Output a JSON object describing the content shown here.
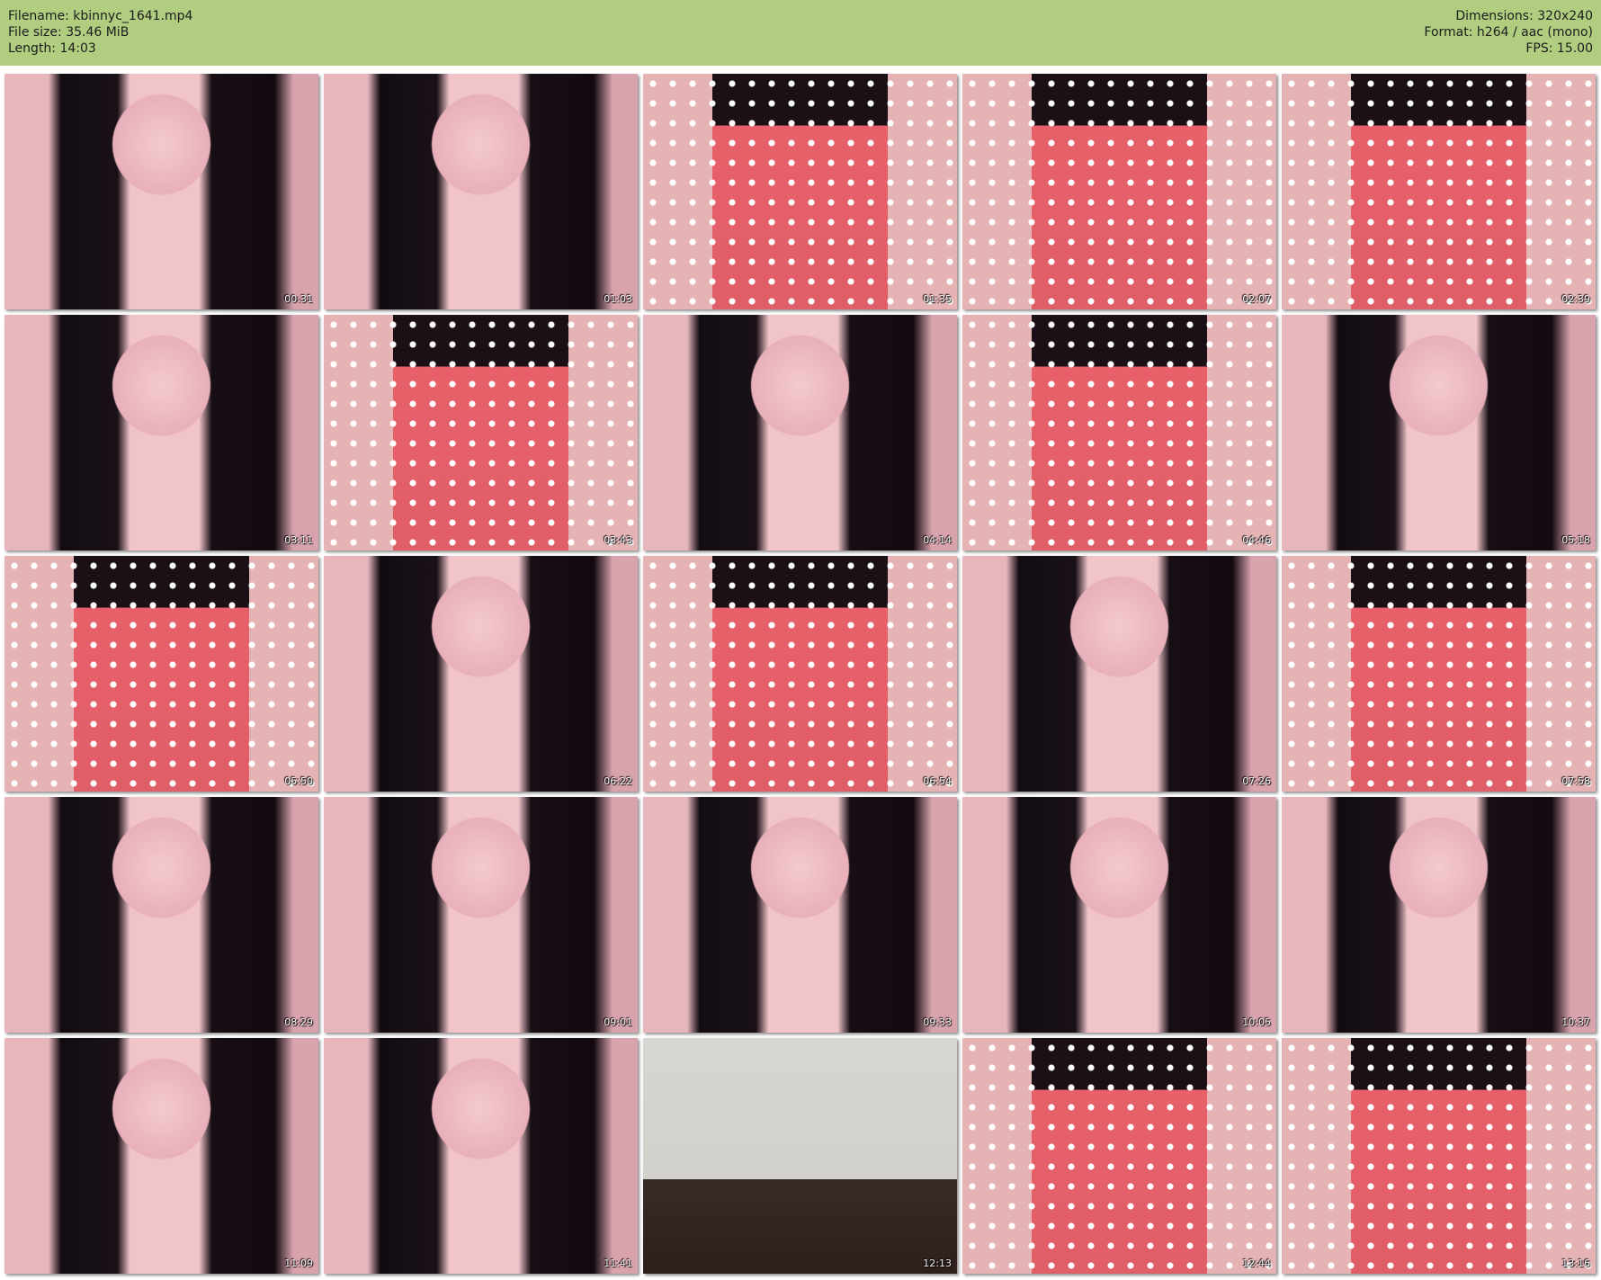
{
  "header": {
    "filename": "Filename: kbinnyc_1641.mp4",
    "filesize": "File size: 35.46 MiB",
    "length": "Length: 14:03",
    "dimensions": "Dimensions: 320x240",
    "format": "Format: h264 / aac (mono)",
    "fps": "FPS: 15.00"
  },
  "thumbnails": [
    {
      "time": "00:31",
      "style": "face"
    },
    {
      "time": "01:03",
      "style": "face"
    },
    {
      "time": "01:35",
      "style": "dress"
    },
    {
      "time": "02:07",
      "style": "dress"
    },
    {
      "time": "02:39",
      "style": "dress"
    },
    {
      "time": "03:11",
      "style": "face"
    },
    {
      "time": "03:43",
      "style": "dress"
    },
    {
      "time": "04:14",
      "style": "face"
    },
    {
      "time": "04:46",
      "style": "dress"
    },
    {
      "time": "05:18",
      "style": "face"
    },
    {
      "time": "05:50",
      "style": "dress"
    },
    {
      "time": "06:22",
      "style": "face"
    },
    {
      "time": "06:54",
      "style": "dress"
    },
    {
      "time": "07:26",
      "style": "face"
    },
    {
      "time": "07:58",
      "style": "dress"
    },
    {
      "time": "08:29",
      "style": "face"
    },
    {
      "time": "09:01",
      "style": "face"
    },
    {
      "time": "09:33",
      "style": "face"
    },
    {
      "time": "10:05",
      "style": "face"
    },
    {
      "time": "10:37",
      "style": "face"
    },
    {
      "time": "11:09",
      "style": "face"
    },
    {
      "time": "11:41",
      "style": "face"
    },
    {
      "time": "12:13",
      "style": "room"
    },
    {
      "time": "12:44",
      "style": "dress"
    },
    {
      "time": "13:16",
      "style": "dress"
    }
  ]
}
